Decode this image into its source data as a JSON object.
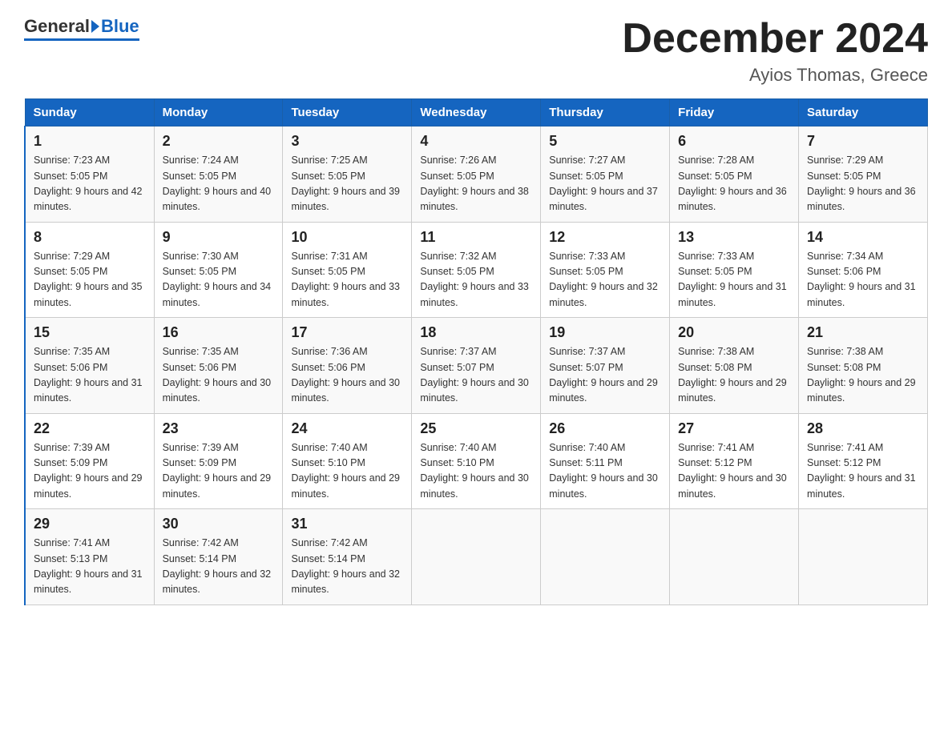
{
  "header": {
    "logo_general": "General",
    "logo_blue": "Blue",
    "month_title": "December 2024",
    "location": "Ayios Thomas, Greece"
  },
  "columns": [
    "Sunday",
    "Monday",
    "Tuesday",
    "Wednesday",
    "Thursday",
    "Friday",
    "Saturday"
  ],
  "weeks": [
    [
      {
        "day": "1",
        "sunrise": "7:23 AM",
        "sunset": "5:05 PM",
        "daylight": "9 hours and 42 minutes."
      },
      {
        "day": "2",
        "sunrise": "7:24 AM",
        "sunset": "5:05 PM",
        "daylight": "9 hours and 40 minutes."
      },
      {
        "day": "3",
        "sunrise": "7:25 AM",
        "sunset": "5:05 PM",
        "daylight": "9 hours and 39 minutes."
      },
      {
        "day": "4",
        "sunrise": "7:26 AM",
        "sunset": "5:05 PM",
        "daylight": "9 hours and 38 minutes."
      },
      {
        "day": "5",
        "sunrise": "7:27 AM",
        "sunset": "5:05 PM",
        "daylight": "9 hours and 37 minutes."
      },
      {
        "day": "6",
        "sunrise": "7:28 AM",
        "sunset": "5:05 PM",
        "daylight": "9 hours and 36 minutes."
      },
      {
        "day": "7",
        "sunrise": "7:29 AM",
        "sunset": "5:05 PM",
        "daylight": "9 hours and 36 minutes."
      }
    ],
    [
      {
        "day": "8",
        "sunrise": "7:29 AM",
        "sunset": "5:05 PM",
        "daylight": "9 hours and 35 minutes."
      },
      {
        "day": "9",
        "sunrise": "7:30 AM",
        "sunset": "5:05 PM",
        "daylight": "9 hours and 34 minutes."
      },
      {
        "day": "10",
        "sunrise": "7:31 AM",
        "sunset": "5:05 PM",
        "daylight": "9 hours and 33 minutes."
      },
      {
        "day": "11",
        "sunrise": "7:32 AM",
        "sunset": "5:05 PM",
        "daylight": "9 hours and 33 minutes."
      },
      {
        "day": "12",
        "sunrise": "7:33 AM",
        "sunset": "5:05 PM",
        "daylight": "9 hours and 32 minutes."
      },
      {
        "day": "13",
        "sunrise": "7:33 AM",
        "sunset": "5:05 PM",
        "daylight": "9 hours and 31 minutes."
      },
      {
        "day": "14",
        "sunrise": "7:34 AM",
        "sunset": "5:06 PM",
        "daylight": "9 hours and 31 minutes."
      }
    ],
    [
      {
        "day": "15",
        "sunrise": "7:35 AM",
        "sunset": "5:06 PM",
        "daylight": "9 hours and 31 minutes."
      },
      {
        "day": "16",
        "sunrise": "7:35 AM",
        "sunset": "5:06 PM",
        "daylight": "9 hours and 30 minutes."
      },
      {
        "day": "17",
        "sunrise": "7:36 AM",
        "sunset": "5:06 PM",
        "daylight": "9 hours and 30 minutes."
      },
      {
        "day": "18",
        "sunrise": "7:37 AM",
        "sunset": "5:07 PM",
        "daylight": "9 hours and 30 minutes."
      },
      {
        "day": "19",
        "sunrise": "7:37 AM",
        "sunset": "5:07 PM",
        "daylight": "9 hours and 29 minutes."
      },
      {
        "day": "20",
        "sunrise": "7:38 AM",
        "sunset": "5:08 PM",
        "daylight": "9 hours and 29 minutes."
      },
      {
        "day": "21",
        "sunrise": "7:38 AM",
        "sunset": "5:08 PM",
        "daylight": "9 hours and 29 minutes."
      }
    ],
    [
      {
        "day": "22",
        "sunrise": "7:39 AM",
        "sunset": "5:09 PM",
        "daylight": "9 hours and 29 minutes."
      },
      {
        "day": "23",
        "sunrise": "7:39 AM",
        "sunset": "5:09 PM",
        "daylight": "9 hours and 29 minutes."
      },
      {
        "day": "24",
        "sunrise": "7:40 AM",
        "sunset": "5:10 PM",
        "daylight": "9 hours and 29 minutes."
      },
      {
        "day": "25",
        "sunrise": "7:40 AM",
        "sunset": "5:10 PM",
        "daylight": "9 hours and 30 minutes."
      },
      {
        "day": "26",
        "sunrise": "7:40 AM",
        "sunset": "5:11 PM",
        "daylight": "9 hours and 30 minutes."
      },
      {
        "day": "27",
        "sunrise": "7:41 AM",
        "sunset": "5:12 PM",
        "daylight": "9 hours and 30 minutes."
      },
      {
        "day": "28",
        "sunrise": "7:41 AM",
        "sunset": "5:12 PM",
        "daylight": "9 hours and 31 minutes."
      }
    ],
    [
      {
        "day": "29",
        "sunrise": "7:41 AM",
        "sunset": "5:13 PM",
        "daylight": "9 hours and 31 minutes."
      },
      {
        "day": "30",
        "sunrise": "7:42 AM",
        "sunset": "5:14 PM",
        "daylight": "9 hours and 32 minutes."
      },
      {
        "day": "31",
        "sunrise": "7:42 AM",
        "sunset": "5:14 PM",
        "daylight": "9 hours and 32 minutes."
      },
      null,
      null,
      null,
      null
    ]
  ]
}
